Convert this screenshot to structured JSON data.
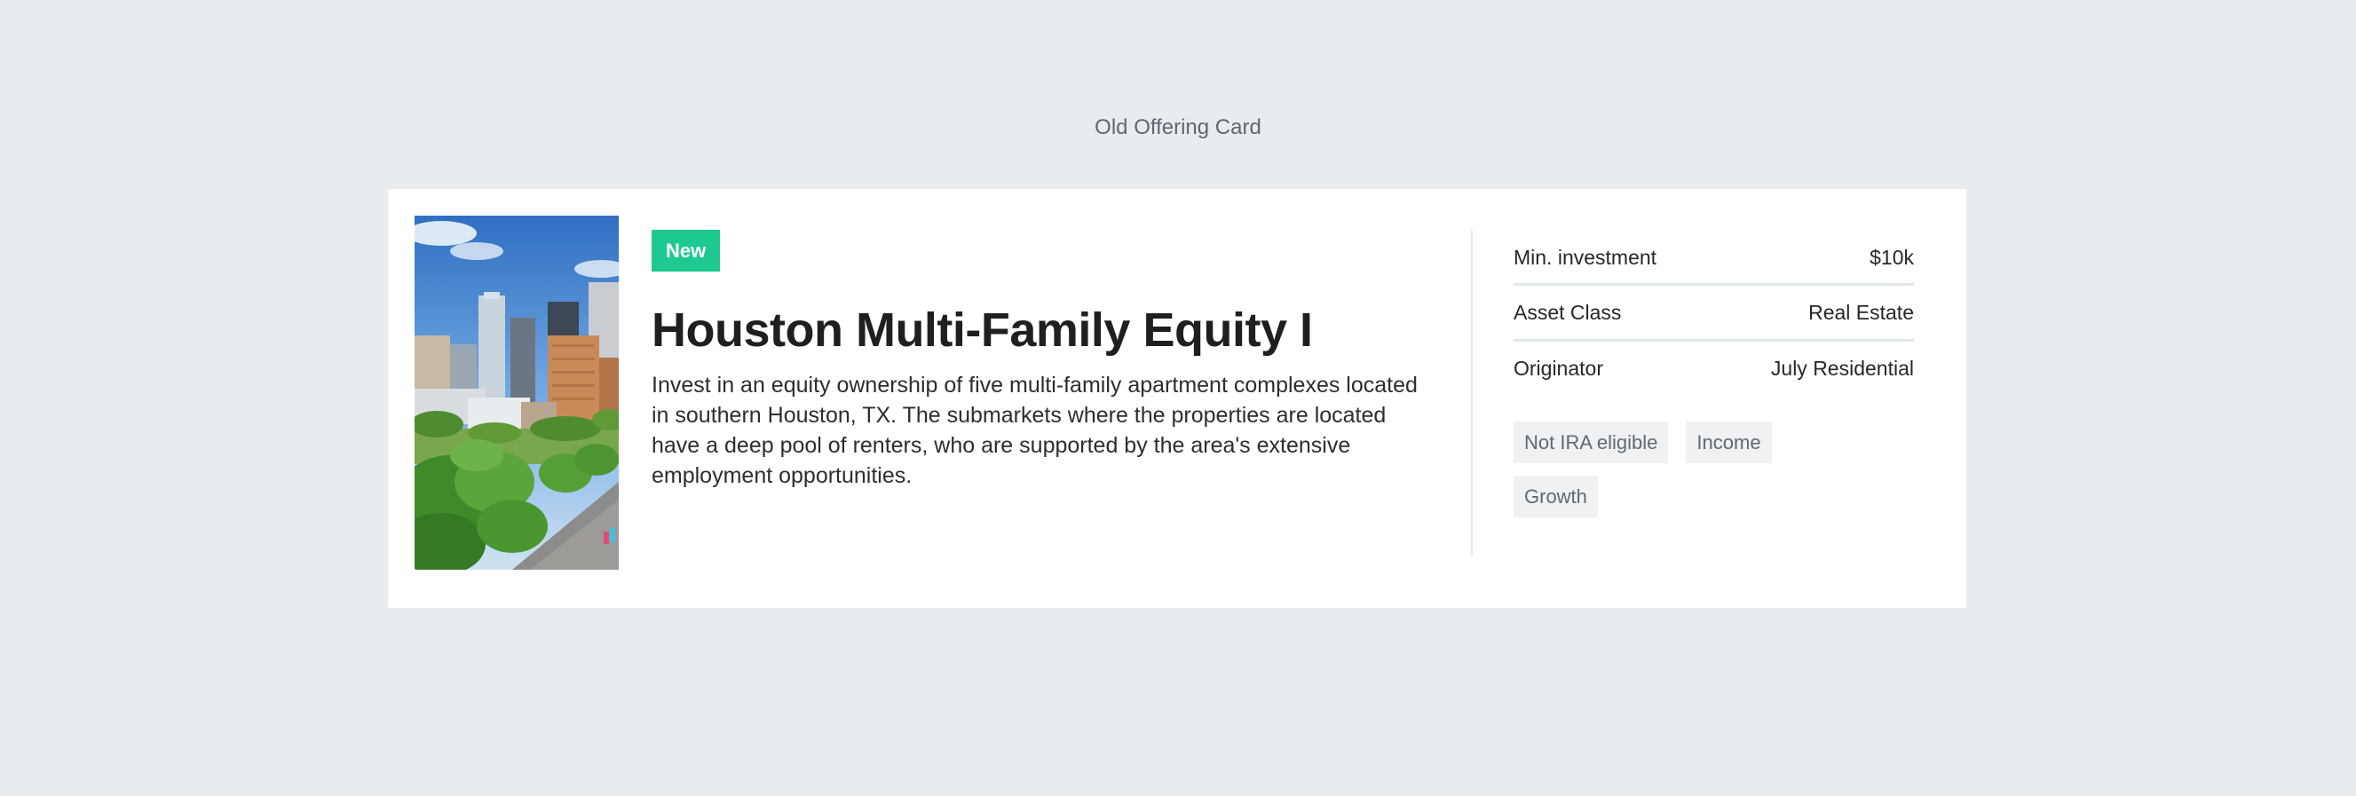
{
  "section_label": "Old Offering Card",
  "card": {
    "badge": "New",
    "title": "Houston Multi-Family Equity I",
    "description": "Invest in an equity ownership of five multi-family apartment complexes located in southern Houston, TX. The submarkets where the properties are located have a deep pool of renters, who are supported by the area's extensive employment opportunities.",
    "image_icon": "city-skyline-photo",
    "details": [
      {
        "label": "Min. investment",
        "value": "$10k"
      },
      {
        "label": "Asset Class",
        "value": "Real Estate"
      },
      {
        "label": "Originator",
        "value": "July Residential"
      }
    ],
    "tags": [
      "Not IRA eligible",
      "Income",
      "Growth"
    ]
  },
  "colors": {
    "background": "#e8ecef",
    "badge": "#1ec991",
    "tag_bg": "#eff1f3"
  }
}
